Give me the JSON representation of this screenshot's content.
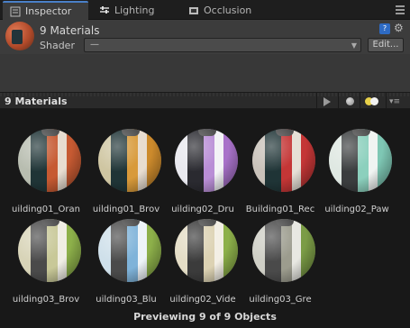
{
  "tabs": [
    {
      "label": "Inspector",
      "icon": "inspector-icon",
      "active": true
    },
    {
      "label": "Lighting",
      "icon": "lighting-icon",
      "active": false
    },
    {
      "label": "Occlusion",
      "icon": "occlusion-icon",
      "active": false
    }
  ],
  "header": {
    "title": "9 Materials",
    "shader_label": "Shader",
    "shader_value": "—",
    "edit_label": "Edit..."
  },
  "preview": {
    "title": "9 Materials",
    "footer": "Previewing 9 of 9 Objects"
  },
  "materials": [
    {
      "label": "uilding01_Oran",
      "colors": [
        "#b8bdb0",
        "#1f3436",
        "#c65a32",
        "#e8ddd0",
        "#c65a32"
      ]
    },
    {
      "label": "uilding01_Brov",
      "colors": [
        "#cfc6a2",
        "#1f3436",
        "#d89a3a",
        "#e8ddd0",
        "#cc8a2c"
      ]
    },
    {
      "label": "uilding02_Dru",
      "colors": [
        "#e9e9ef",
        "#2a2a30",
        "#b98ed6",
        "#f3f3f6",
        "#a872c9"
      ]
    },
    {
      "label": "Building01_Rec",
      "colors": [
        "#c9c2ba",
        "#1f3436",
        "#c43636",
        "#e6e0d6",
        "#c43636"
      ]
    },
    {
      "label": "uilding02_Paw",
      "colors": [
        "#dfe8e2",
        "#3a3d3e",
        "#8cd0bd",
        "#f0f4f2",
        "#7ec7b4"
      ]
    },
    {
      "label": "uilding03_Brov",
      "colors": [
        "#d8d4b8",
        "#4a4a4a",
        "#c8c898",
        "#f0eee4",
        "#8db04a"
      ]
    },
    {
      "label": "uilding03_Blu",
      "colors": [
        "#cfe0ea",
        "#4a4a4a",
        "#7fb3d9",
        "#eef4f8",
        "#8db04a"
      ]
    },
    {
      "label": "uilding02_Vide",
      "colors": [
        "#e4ddc6",
        "#3b3b3b",
        "#dcd2b3",
        "#f3efe5",
        "#8db04a"
      ]
    },
    {
      "label": "uilding03_Gre",
      "colors": [
        "#cfcfc6",
        "#4a4a4a",
        "#9c9c8e",
        "#e8e8e2",
        "#7b9c46"
      ]
    }
  ]
}
